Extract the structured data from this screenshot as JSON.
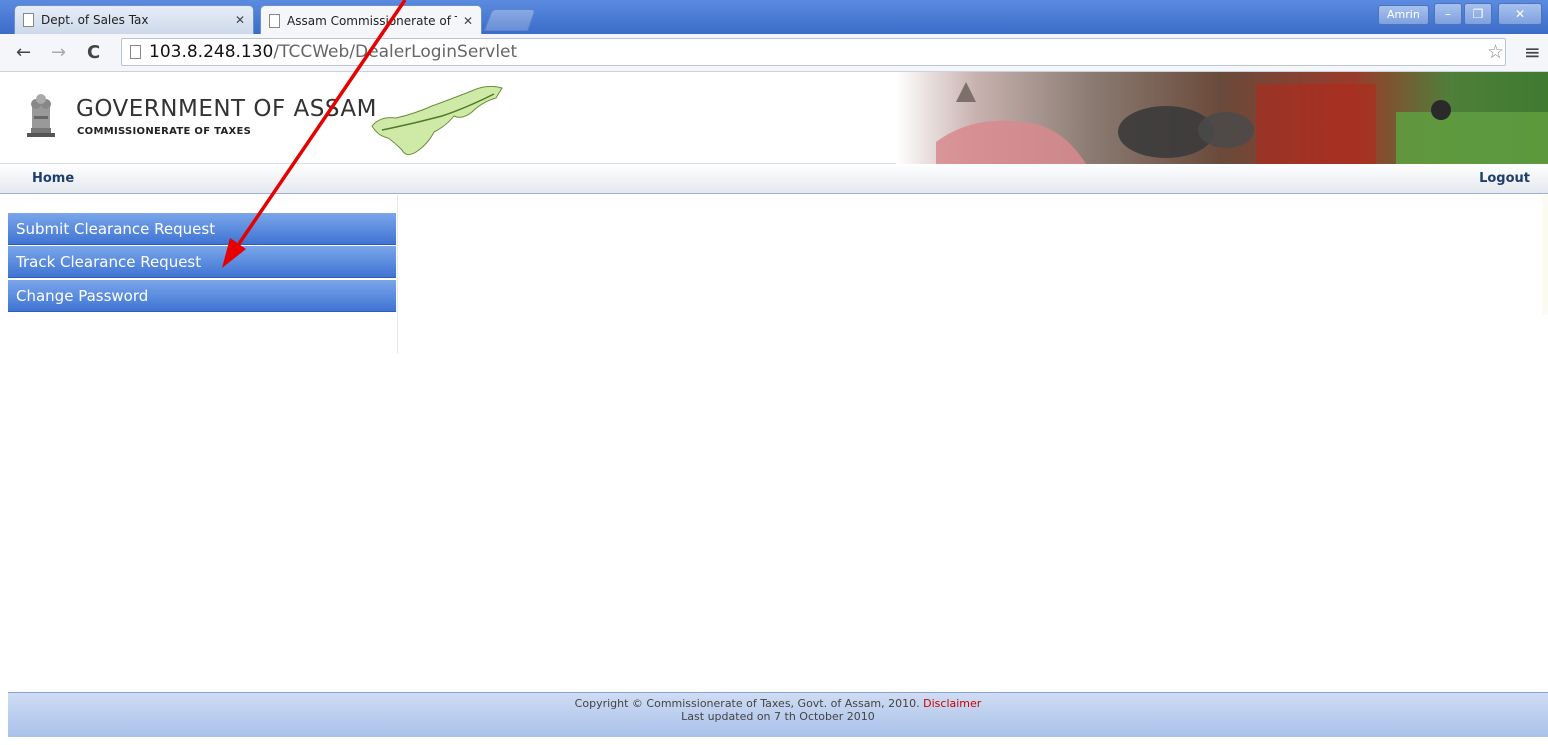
{
  "browser": {
    "tabs": [
      {
        "title": "Dept. of Sales Tax",
        "active": false
      },
      {
        "title": "Assam Commissionerate of T",
        "active": true
      }
    ],
    "user_badge": "Amrin",
    "url_host": "103.8.248.130",
    "url_path": "/TCCWeb/DealerLoginServlet"
  },
  "header": {
    "title": "GOVERNMENT OF ASSAM",
    "subtitle": "COMMISSIONERATE OF TAXES"
  },
  "navbar": {
    "home": "Home",
    "logout": "Logout"
  },
  "sidebar": {
    "items": [
      {
        "label": "Submit Clearance Request"
      },
      {
        "label": "Track Clearance Request"
      },
      {
        "label": "Change Password"
      }
    ]
  },
  "footer": {
    "copyright": "Copyright © Commissionerate of Taxes, Govt. of Assam, 2010.",
    "disclaimer": "Disclaimer",
    "updated": "Last updated on 7 th October 2010"
  },
  "colors": {
    "menu_blue": "#3f74d3",
    "annotation_arrow": "#e60000",
    "nav_text": "#1f3f6e"
  }
}
